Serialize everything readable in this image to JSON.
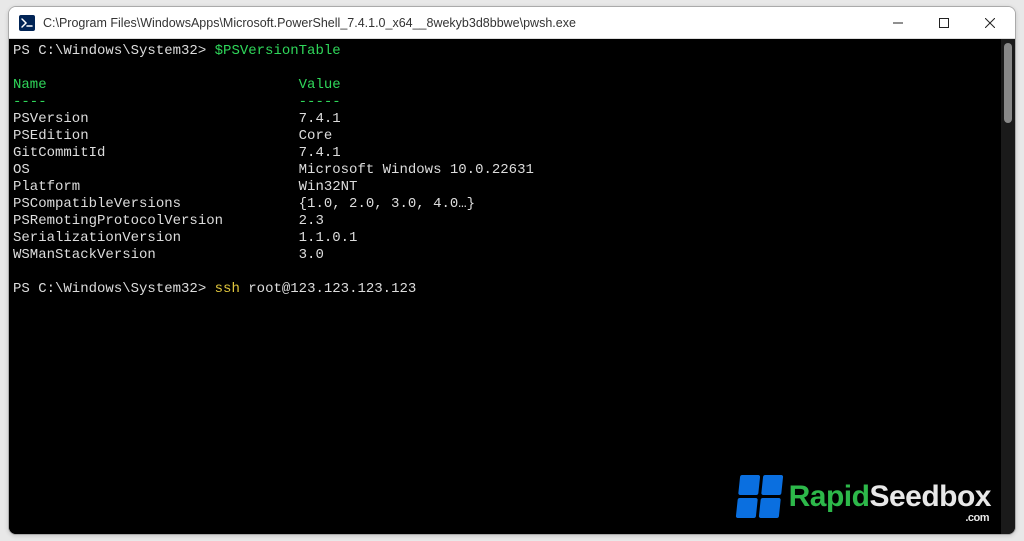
{
  "window": {
    "title": "C:\\Program Files\\WindowsApps\\Microsoft.PowerShell_7.4.1.0_x64__8wekyb3d8bbwe\\pwsh.exe"
  },
  "terminal": {
    "prompt1_prefix": "PS C:\\Windows\\System32> ",
    "prompt1_cmd": "$PSVersionTable",
    "header_name": "Name",
    "header_value": "Value",
    "header_name_underline": "----",
    "header_value_underline": "-----",
    "rows": [
      {
        "name": "PSVersion",
        "value": "7.4.1"
      },
      {
        "name": "PSEdition",
        "value": "Core"
      },
      {
        "name": "GitCommitId",
        "value": "7.4.1"
      },
      {
        "name": "OS",
        "value": "Microsoft Windows 10.0.22631"
      },
      {
        "name": "Platform",
        "value": "Win32NT"
      },
      {
        "name": "PSCompatibleVersions",
        "value": "{1.0, 2.0, 3.0, 4.0…}"
      },
      {
        "name": "PSRemotingProtocolVersion",
        "value": "2.3"
      },
      {
        "name": "SerializationVersion",
        "value": "1.1.0.1"
      },
      {
        "name": "WSManStackVersion",
        "value": "3.0"
      }
    ],
    "prompt2_prefix": "PS C:\\Windows\\System32> ",
    "prompt2_cmd_yellow": "ssh",
    "prompt2_cmd_rest": " root@123.123.123.123"
  },
  "watermark": {
    "text_a": "Rapid",
    "text_b": "Seedbox",
    "dotcom": ".com"
  }
}
